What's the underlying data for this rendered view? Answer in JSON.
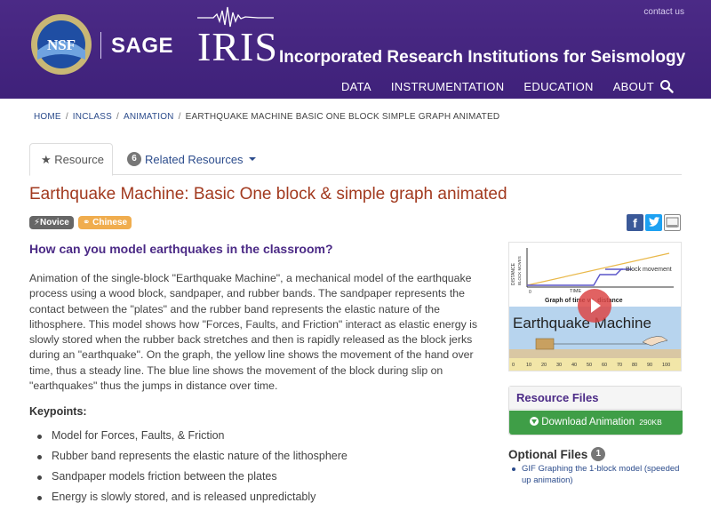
{
  "header": {
    "contact": "contact us",
    "nsf": "NSF",
    "sage": "SAGE",
    "iris": "IRIS",
    "iris_full": "Incorporated Research Institutions for Seismology",
    "nav": [
      "DATA",
      "INSTRUMENTATION",
      "EDUCATION",
      "ABOUT"
    ]
  },
  "breadcrumb": {
    "items": [
      "HOME",
      "INCLASS",
      "ANIMATION"
    ],
    "current": "EARTHQUAKE MACHINE BASIC ONE BLOCK SIMPLE GRAPH ANIMATED"
  },
  "tabs": {
    "resource": "Resource",
    "related_count": "6",
    "related": "Related Resources"
  },
  "title": "Earthquake Machine: Basic One block & simple graph animated",
  "tags": {
    "level": "Novice",
    "language": "Chinese"
  },
  "share": {
    "facebook": "f"
  },
  "question": "How can you model earthquakes in the classroom?",
  "description": "Animation of the single-block \"Earthquake Machine\", a mechanical model of the earthquake process using a wood block, sandpaper, and rubber bands. The sandpaper represents the contact between the \"plates\" and the rubber band represents the elastic nature of the lithosphere. This model shows how \"Forces, Faults, and Friction\" interact as elastic energy is slowly stored when the rubber back stretches and then is rapidly released as the block jerks during an \"earthquake\". On the graph, the yellow line shows the movement of the hand over time, thus a steady line. The blue line shows the movement of the block during slip on \"earthquakes\" thus the jumps in distance over time.",
  "keypoints": {
    "title": "Keypoints:",
    "items": [
      "Model for Forces, Faults, & Friction",
      "Rubber band represents the elastic nature of the lithosphere",
      "Sandpaper models friction between the plates",
      "Energy is slowly stored, and is released unpredictably"
    ]
  },
  "thumbnail": {
    "ylabel_1": "DISTANCE",
    "ylabel_2": "BLOCK MOVES",
    "legend": "Block movement",
    "x_zero": "0",
    "x_label": "TIME",
    "graph_caption": "Graph of time vs. distance",
    "machine_label": "Earthquake Machine",
    "ruler": [
      "0",
      "10",
      "20",
      "30",
      "40",
      "50",
      "60",
      "70",
      "80",
      "90",
      "100"
    ]
  },
  "resource_files": {
    "title": "Resource Files",
    "download_label": "Download Animation",
    "download_size": "290KB"
  },
  "optional_files": {
    "title": "Optional Files",
    "count": "1",
    "item": "GIF Graphing the 1-block model (speeded up animation)"
  },
  "colors": {
    "header_bg": "#3f217a",
    "title_red": "#a23a1f",
    "accent_purple": "#4b2a86",
    "link_blue": "#2c4c8c",
    "download_green": "#3f9e47",
    "chinese_orange": "#f0ad4e"
  }
}
